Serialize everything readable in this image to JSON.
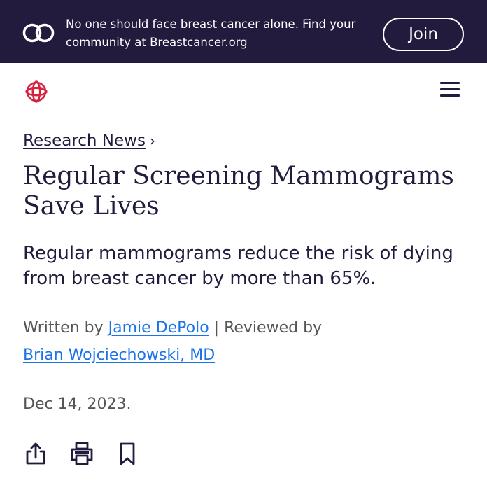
{
  "banner": {
    "text": "No one should face breast cancer alone. Find your community at Breastcancer.org",
    "join_label": "Join",
    "background_color": "#231b3d"
  },
  "header": {
    "logo_icon": "breastcancer-org-logo-icon",
    "menu_icon": "hamburger-menu-icon",
    "logo_color": "#d6223f"
  },
  "breadcrumb": {
    "label": "Research News",
    "separator": "›"
  },
  "article": {
    "title": "Regular Screening Mammograms Save Lives",
    "subtitle": "Regular mammograms reduce the risk of dying from breast cancer by more than 65%.",
    "written_by_prefix": "Written by",
    "author": "Jamie DePolo",
    "reviewed_by_prefix": "| Reviewed by",
    "reviewer": "Brian Wojciechowski, MD",
    "date": "Dec 14, 2023.",
    "link_color": "#1a73e8"
  },
  "actions": {
    "share_icon": "share-icon",
    "print_icon": "print-icon",
    "bookmark_icon": "bookmark-icon"
  }
}
